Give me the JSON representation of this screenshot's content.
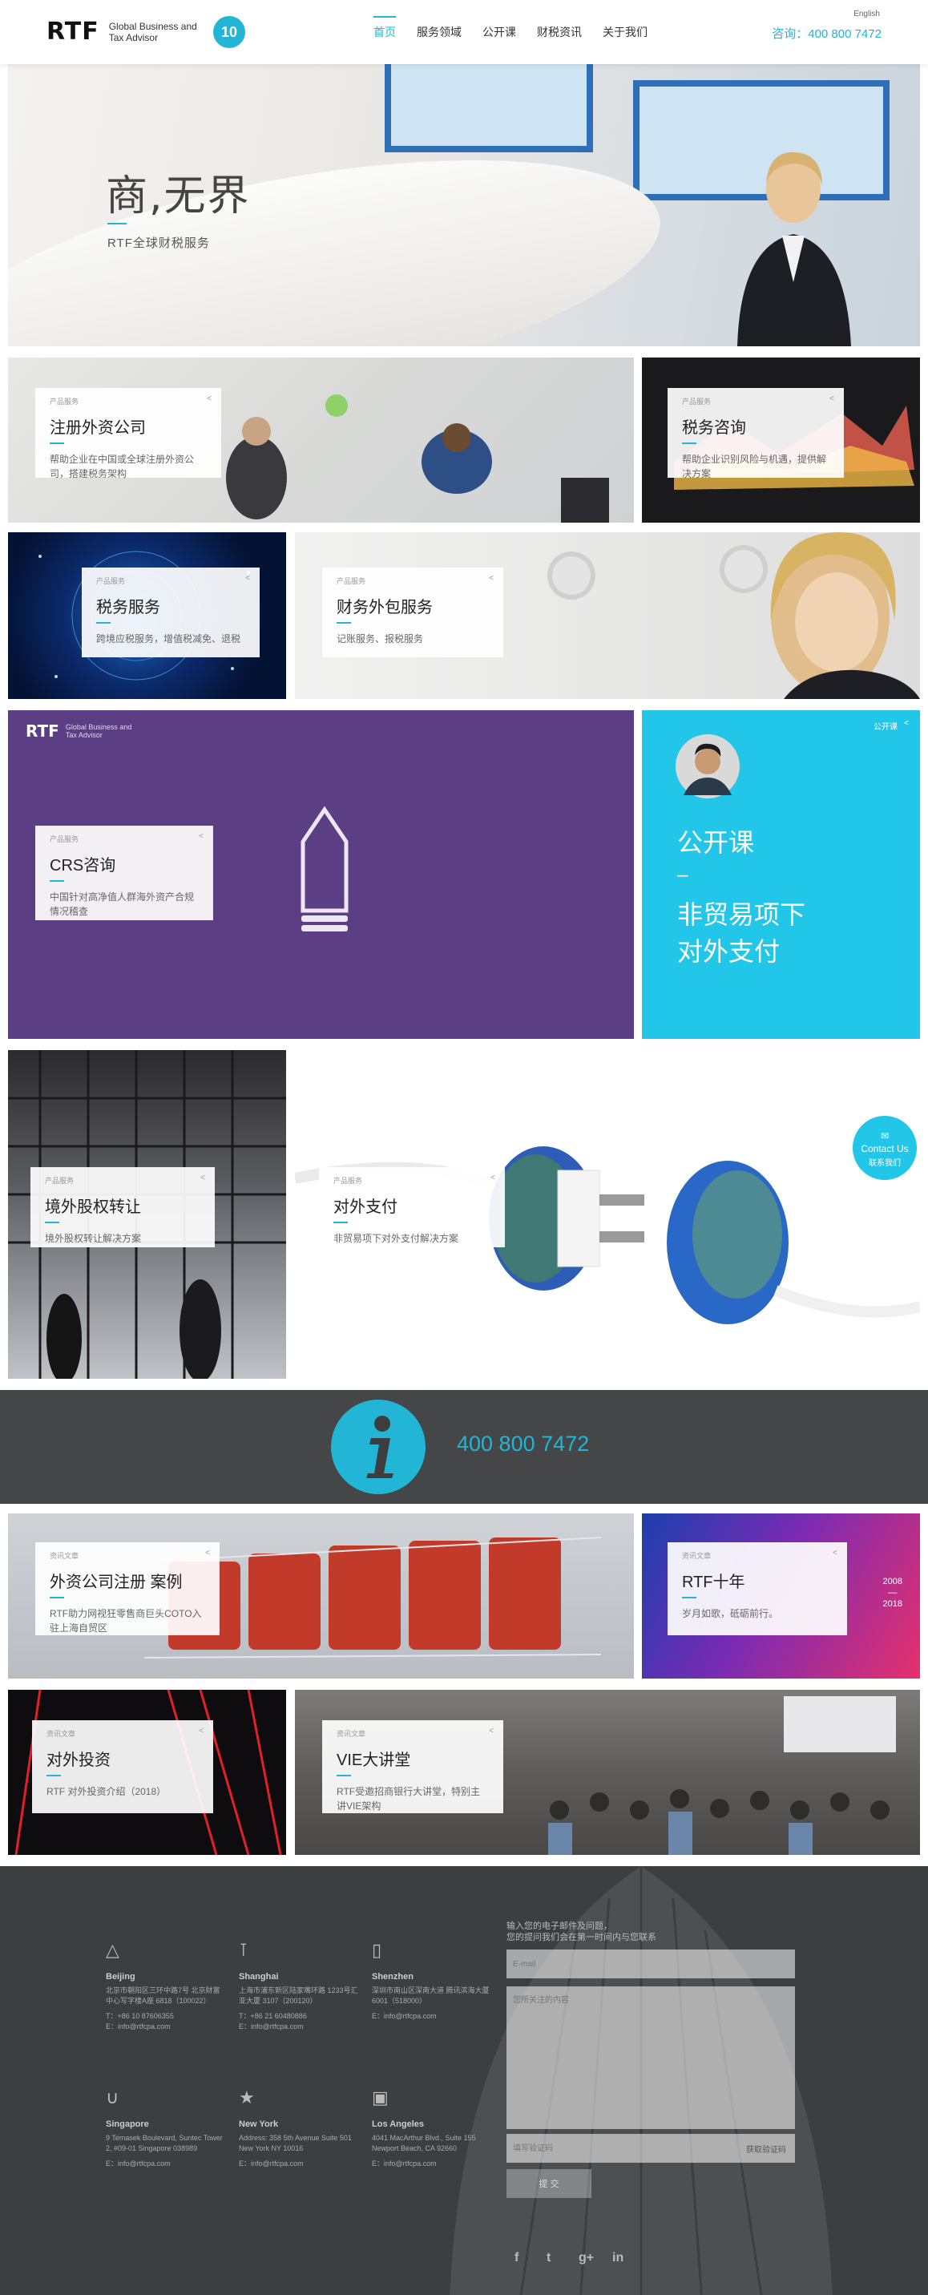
{
  "header": {
    "logo_mark": "RTF",
    "logo_line1": "Global Business and",
    "logo_line2": "Tax Advisor",
    "badge": "10",
    "nav": [
      "首页",
      "服务领域",
      "公开课",
      "财税资讯",
      "关于我们"
    ],
    "lang": "English",
    "phone": "咨询：400 800 7472"
  },
  "hero": {
    "title": "商,无界",
    "subtitle": "RTF全球财税服务"
  },
  "tiles": {
    "t1": {
      "tag": "产品服务",
      "title": "注册外资公司",
      "desc": "帮助企业在中国或全球注册外资公司，搭建税务架构"
    },
    "t2": {
      "tag": "产品服务",
      "title": "税务咨询",
      "desc": "帮助企业识别风险与机遇，提供解决方案"
    },
    "t3": {
      "tag": "产品服务",
      "title": "税务服务",
      "desc": "跨境应税服务，增值税减免、退税"
    },
    "t4": {
      "tag": "产品服务",
      "title": "财务外包服务",
      "desc": "记账服务、报税服务"
    },
    "t5": {
      "tag": "产品服务",
      "title": "CRS咨询",
      "desc": "中国针对高净值人群海外资产合规情况稽查",
      "logo_mark": "RTF",
      "logo_line1": "Global Business and",
      "logo_line2": "Tax Advisor"
    },
    "t6": {
      "tag": "公开课",
      "title": "公开课",
      "dash": "–",
      "subtitle1": "非贸易项下",
      "subtitle2": "对外支付"
    },
    "t7": {
      "tag": "产品服务",
      "title": "境外股权转让",
      "desc": "境外股权转让解决方案"
    },
    "t8": {
      "tag": "产品服务",
      "title": "对外支付",
      "desc": "非贸易项下对外支付解决方案"
    },
    "t9": {
      "tag": "资讯文章",
      "title": "外资公司注册 案例",
      "desc": "RTF助力网视狂零售商巨头COTO入驻上海自贸区"
    },
    "t10": {
      "tag": "资讯文章",
      "title": "RTF十年",
      "desc": "岁月如歌，砥砺前行。",
      "year1": "2008",
      "year2": "2018"
    },
    "t11": {
      "tag": "资讯文章",
      "title": "对外投资",
      "desc": "RTF 对外投资介绍（2018）"
    },
    "t12": {
      "tag": "资讯文章",
      "title": "VIE大讲堂",
      "desc": "RTF受邀招商银行大讲堂，特别主讲VIE架构"
    }
  },
  "info": {
    "phone": "400 800 7472"
  },
  "contact_float": {
    "line1": "Contact Us",
    "line2": "联系我们"
  },
  "footer": {
    "cities": [
      {
        "name": "Beijing",
        "icon": "temple-icon",
        "addr": "北京市朝阳区三环中路7号 北京财富中心写字楼A座 6818（100022）",
        "tel": "T：+86 10 87606355",
        "email": "E：info@rtfcpa.com"
      },
      {
        "name": "Shanghai",
        "icon": "tower-icon",
        "addr": "上海市浦东新区陆家嘴环路 1233号汇亚大厦 3107（200120）",
        "tel": "T：+86 21 60480886",
        "email": "E：info@rtfcpa.com"
      },
      {
        "name": "Shenzhen",
        "icon": "skyscraper-icon",
        "addr": "深圳市南山区深南大道 腾讯滨海大厦 6001（518000）",
        "tel": "",
        "email": "E：info@rtfcpa.com"
      },
      {
        "name": "Singapore",
        "icon": "merlion-icon",
        "addr": "9 Temasek Boulevard, Suntec Tower 2, #09-01 Singapore 038989",
        "tel": "",
        "email": "E：info@rtfcpa.com"
      },
      {
        "name": "New York",
        "icon": "liberty-icon",
        "addr": "Address: 358 5th Avenue Suite 501 New York NY 10016",
        "tel": "",
        "email": "E：info@rtfcpa.com"
      },
      {
        "name": "Los Angeles",
        "icon": "capitol-icon",
        "addr": "4041 MacArthur Blvd., Suite 155 Newport Beach, CA 92660",
        "tel": "",
        "email": "E：info@rtfcpa.com"
      }
    ],
    "form_intro1": "输入您的电子邮件及问题，",
    "form_intro2": "您的提问我们会在第一时间内与您联系",
    "email_placeholder": "E-mail",
    "message_placeholder": "您所关注的内容",
    "code_placeholder": "填写验证码",
    "code_label": "获取验证码",
    "submit": "提 交",
    "social": [
      "f",
      "t",
      "g+",
      "in"
    ]
  }
}
